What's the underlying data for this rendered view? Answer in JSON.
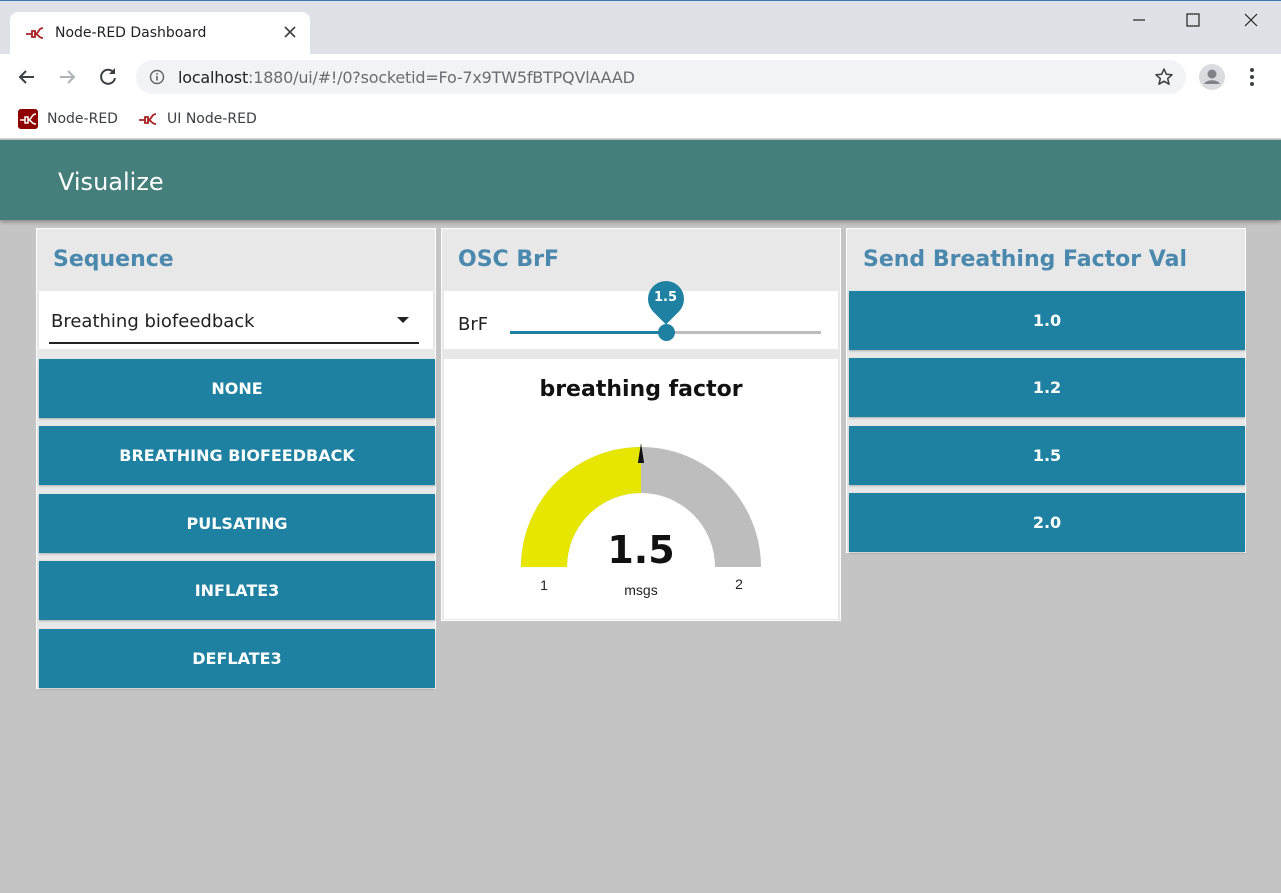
{
  "browser": {
    "tab_title": "Node-RED Dashboard",
    "url_host": "localhost",
    "url_path": ":1880/ui/#!/0?socketid=Fo-7x9TW5fBTPQVlAAAD",
    "bookmarks": [
      "Node-RED",
      "UI Node-RED"
    ]
  },
  "dashboard": {
    "title": "Visualize",
    "colors": {
      "header": "#447f7c",
      "button": "#1e81a1",
      "card_title": "#4a88ae",
      "gauge_fill": "#e6e600",
      "gauge_bg": "#bdbdbd"
    }
  },
  "sequence": {
    "title": "Sequence",
    "selected": "Breathing biofeedback",
    "buttons": [
      "NONE",
      "BREATHING BIOFEEDBACK",
      "PULSATING",
      "INFLATE3",
      "DEFLATE3"
    ]
  },
  "osc": {
    "title": "OSC BrF",
    "slider_label": "BrF",
    "slider_value": "1.5",
    "slider_fraction": 0.5,
    "gauge": {
      "title": "breathing factor",
      "value": "1.5",
      "units": "msgs",
      "min": "1",
      "max": "2",
      "fraction": 0.5
    }
  },
  "send": {
    "title": "Send Breathing Factor Val",
    "buttons": [
      "1.0",
      "1.2",
      "1.5",
      "2.0"
    ]
  }
}
